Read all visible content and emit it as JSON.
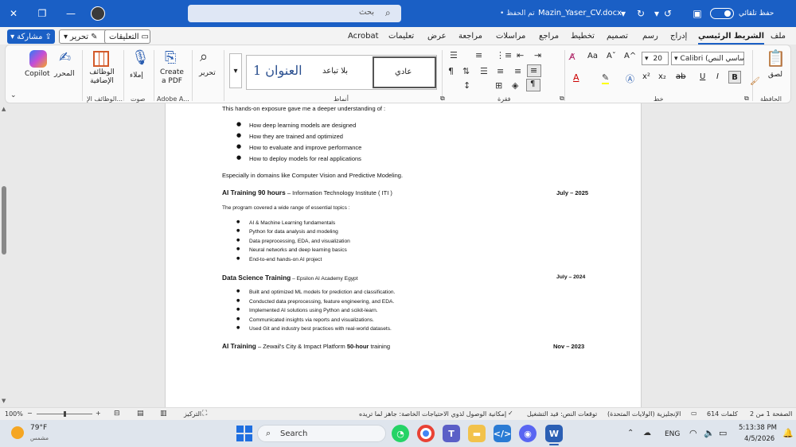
{
  "titlebar": {
    "autosave_label": "حفظ تلقائي",
    "file_name": "Mazin_Yaser_CV.docx",
    "saved_status": "• تم الحفظ",
    "search_placeholder": "بحث",
    "minimize": "—",
    "restore": "❐",
    "close": "✕"
  },
  "menu": {
    "tabs": [
      "ملف",
      "الشريط الرئيسي",
      "إدراج",
      "رسم",
      "تصميم",
      "تخطيط",
      "مراجع",
      "مراسلات",
      "مراجعة",
      "عرض",
      "تعليمات",
      "Acrobat"
    ],
    "active": "الشريط الرئيسي",
    "comments": "التعليقات",
    "editing": "تحرير",
    "share": "مشاركة"
  },
  "ribbon": {
    "clipboard": {
      "paste": "لصق",
      "group": "الحافظة"
    },
    "font": {
      "name": "Calibri (أساسي النص)",
      "size": "20",
      "group": "خط",
      "bold": "B",
      "italic": "I",
      "underline": "U",
      "strike": "ab",
      "sub": "x₂",
      "sup": "x²",
      "grow": "A^",
      "shrink": "Aˇ",
      "case": "Aa"
    },
    "paragraph": {
      "group": "فقرة"
    },
    "styles": {
      "normal": "عادي",
      "no_spacing": "بلا تباعد",
      "heading1": "العنوان 1",
      "group": "أنماط"
    },
    "editing_group": {
      "label": "تحرير"
    },
    "adobe": {
      "label": "Create a PDF",
      "group": "Adobe A..."
    },
    "voice": {
      "label": "إملاء",
      "group": "صوت"
    },
    "addins": {
      "label": "الوظائف الإضافية",
      "group": "الوظائف الإ..."
    },
    "editor": {
      "label": "المحرر"
    },
    "copilot": {
      "label": "Copilot"
    }
  },
  "document": {
    "intro": "This hands-on exposure gave me a deeper understanding of :",
    "bullets1": [
      " How deep learning models are designed",
      "How they are trained and optimized",
      "How to evaluate and improve performance",
      "How to deploy models for real applications"
    ],
    "domains": "Especially in domains like Computer Vision and Predictive Modeling.",
    "s1": {
      "title": "AI Training 90 hours",
      "rest": " – Information Technology Institute ( ITI )",
      "date": "July – 2025",
      "intro": "The program covered a wide range of essential topics :",
      "bullets": [
        "AI & Machine Learning fundamentals",
        "Python for data analysis and modeling",
        "Data preprocessing, EDA, and visualization",
        "Neural networks and deep learning basics",
        "End-to-end hands-on AI project"
      ]
    },
    "s2": {
      "title": "Data Science Training",
      "rest": " – Epsilon AI Academy Egypt",
      "date": "July – 2024",
      "bullets": [
        "Built and optimized ML models for prediction and classification.",
        "Conducted data preprocessing, feature engineering, and EDA.",
        "Implemented AI solutions using Python and scikit-learn.",
        "Communicated insights via reports and visualizations.",
        "Used Git and industry best practices with real-world datasets."
      ]
    },
    "s3": {
      "title": "AI Training",
      "mid": " – Zewail's City & Impact Platform ",
      "bold2": "50-hour",
      "rest": " training",
      "date": "Nov – 2023"
    }
  },
  "status": {
    "page": "الصفحة 1 من 2",
    "words": "614 كلمات",
    "language": "الإنجليزية (الولايات المتحدة)",
    "predictions": "توقعات النص: قيد التشغيل",
    "accessibility": "إمكانية الوصول لذوي الاحتياجات الخاصة: جاهز لما تريده",
    "focus": "التركيز",
    "zoom": "100%"
  },
  "taskbar": {
    "temp": "79°F",
    "weather": "مشمس",
    "search": "Search",
    "lang": "ENG",
    "time": "5:13:38 PM",
    "date": "4/5/2026"
  }
}
